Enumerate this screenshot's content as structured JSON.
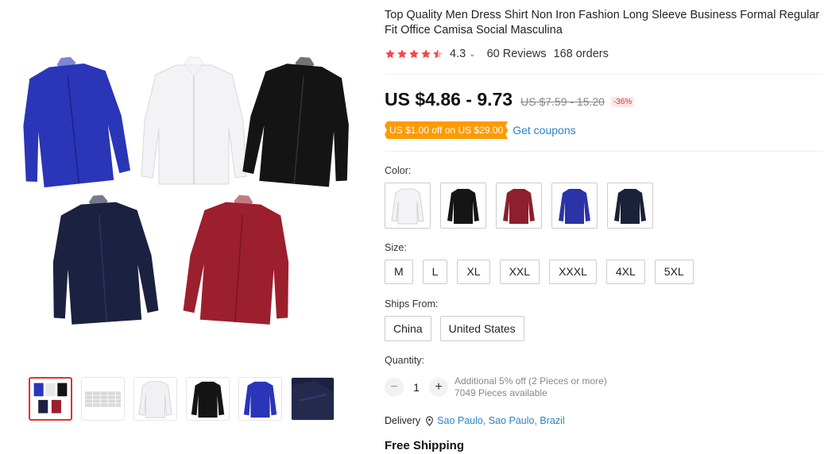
{
  "product": {
    "title": "Top Quality Men Dress Shirt Non Iron Fashion Long Sleeve Business Formal Regular Fit Office Camisa Social Masculina",
    "rating": "4.3",
    "rating_value": 4.3,
    "rating_caret": "⌄",
    "reviews": "60 Reviews",
    "orders": "168 orders"
  },
  "price": {
    "current": "US $4.86 - 9.73",
    "original": "US $7.59 - 15.20",
    "discount": "-36%"
  },
  "coupon": {
    "tag": "US $1.00 off on US $29.00",
    "link": "Get coupons"
  },
  "options": {
    "color_label": "Color:",
    "colors": [
      "#ffffff",
      "#151515",
      "#8e1f2d",
      "#2b33a8",
      "#1b2138"
    ],
    "size_label": "Size:",
    "sizes": [
      "M",
      "L",
      "XL",
      "XXL",
      "XXXL",
      "4XL",
      "5XL"
    ],
    "ships_label": "Ships From:",
    "ships": [
      "China",
      "United States"
    ]
  },
  "quantity": {
    "label": "Quantity:",
    "minus": "−",
    "plus": "+",
    "value": "1",
    "note": "Additional 5% off (2 Pieces or more)",
    "available": "7049 Pieces available"
  },
  "delivery": {
    "label": "Delivery",
    "location": "Sao Paulo, Sao Paulo, Brazil"
  },
  "shipping": "Free Shipping",
  "colors": {
    "accent_red": "#e0322b",
    "link_blue": "#2a84c3",
    "coupon_orange": "#ff9a00",
    "star": "#f5484b"
  },
  "icons": [
    "star-icon",
    "chevron-down-icon",
    "location-pin-icon",
    "minus-icon",
    "plus-icon"
  ]
}
